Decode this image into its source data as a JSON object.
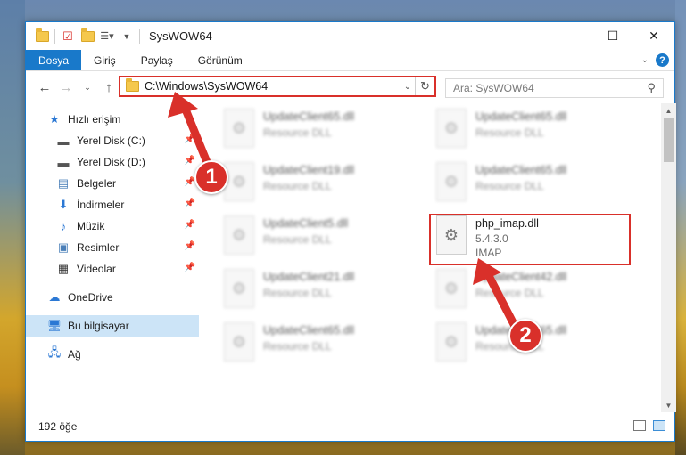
{
  "window": {
    "title": "SysWOW64",
    "controls": {
      "minimize": "—",
      "maximize": "☐",
      "close": "✕"
    }
  },
  "ribbon": {
    "tabs": [
      "Dosya",
      "Giriş",
      "Paylaş",
      "Görünüm"
    ]
  },
  "address_bar": {
    "path": "C:\\Windows\\SysWOW64",
    "search_placeholder": "Ara: SysWOW64"
  },
  "sidebar": {
    "quick_access": "Hızlı erişim",
    "items": [
      {
        "label": "Yerel Disk (C:)",
        "icon": "drive-icon"
      },
      {
        "label": "Yerel Disk (D:)",
        "icon": "drive-icon"
      },
      {
        "label": "Belgeler",
        "icon": "documents-icon"
      },
      {
        "label": "İndirmeler",
        "icon": "download-icon"
      },
      {
        "label": "Müzik",
        "icon": "music-icon"
      },
      {
        "label": "Resimler",
        "icon": "pictures-icon"
      },
      {
        "label": "Videolar",
        "icon": "video-icon"
      }
    ],
    "onedrive": "OneDrive",
    "this_pc": "Bu bilgisayar",
    "network": "Ağ"
  },
  "files": [
    {
      "name": "UpdateClient65.dll",
      "sub": "Resource DLL",
      "blurred": true
    },
    {
      "name": "UpdateClient65.dll",
      "sub": "Resource DLL",
      "blurred": true
    },
    {
      "name": "UpdateClient19.dll",
      "sub": "Resource DLL",
      "blurred": true
    },
    {
      "name": "UpdateClient65.dll",
      "sub": "Resource DLL",
      "blurred": true
    },
    {
      "name": "UpdateClient5.dll",
      "sub": "Resource DLL",
      "blurred": true
    },
    {
      "name": "php_imap.dll",
      "version": "5.4.3.0",
      "sub": "IMAP",
      "blurred": false
    },
    {
      "name": "UpdateClient21.dll",
      "sub": "Resource DLL",
      "blurred": true
    },
    {
      "name": "UpdateClient42.dll",
      "sub": "Resource DLL",
      "blurred": true
    },
    {
      "name": "UpdateClient65.dll",
      "sub": "Resource DLL",
      "blurred": true
    },
    {
      "name": "UpdateClient65.dll",
      "sub": "Resource DLL",
      "blurred": true
    }
  ],
  "status": {
    "item_count": "192 öğe"
  },
  "annotations": {
    "step1": "1",
    "step2": "2",
    "color": "#d9302a"
  }
}
